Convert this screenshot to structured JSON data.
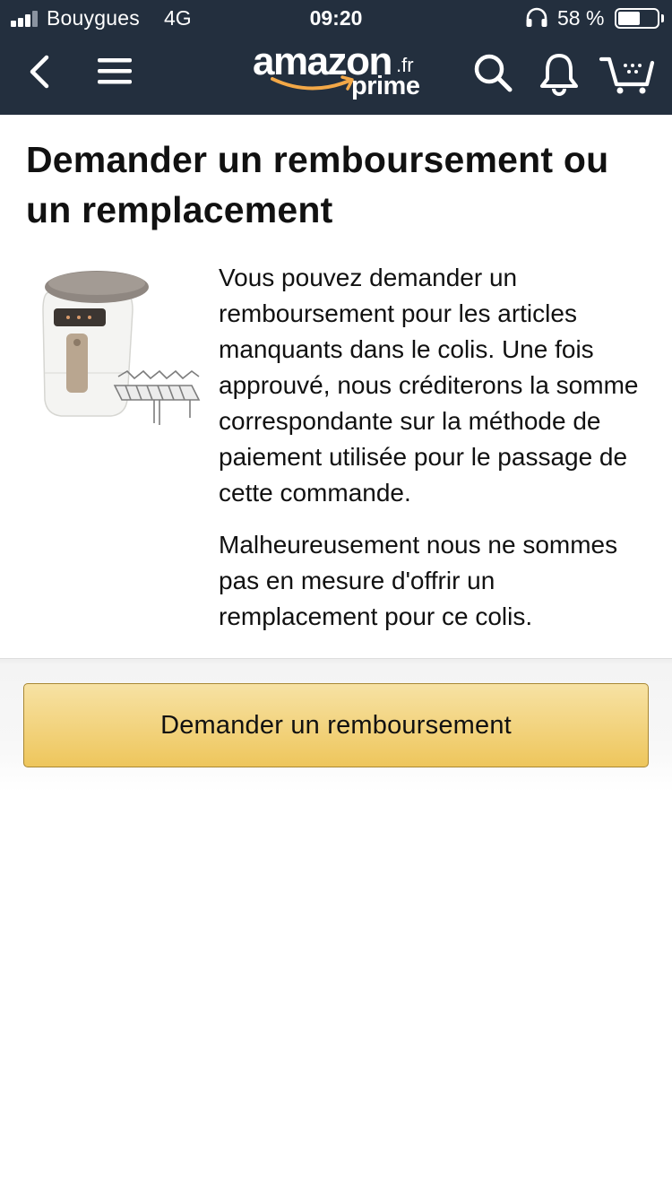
{
  "status_bar": {
    "carrier": "Bouygues",
    "network": "4G",
    "time": "09:20",
    "battery_percent": "58 %",
    "battery_level": 0.58
  },
  "header": {
    "logo_text": "amazon",
    "logo_suffix": ".fr",
    "logo_sub": "prime",
    "bg_color": "#232f3e",
    "accent_color": "#f3a847",
    "icons": [
      "back-icon",
      "menu-icon",
      "search-icon",
      "bell-icon",
      "cart-icon"
    ]
  },
  "page": {
    "title": "Demander un remboursement ou un remplacement",
    "product_image_alt": "",
    "paragraph_1": "Vous pouvez demander un remboursement pour les articles manquants dans le colis. Une fois approuvé, nous créditerons la somme correspondante sur la méthode de paiement utilisée pour le passage de cette commande.",
    "paragraph_2": "Malheureusement nous ne sommes pas en mesure d'offrir un remplacement pour ce colis.",
    "refund_button": "Demander un remboursement",
    "button_color": "#f0c14b"
  }
}
